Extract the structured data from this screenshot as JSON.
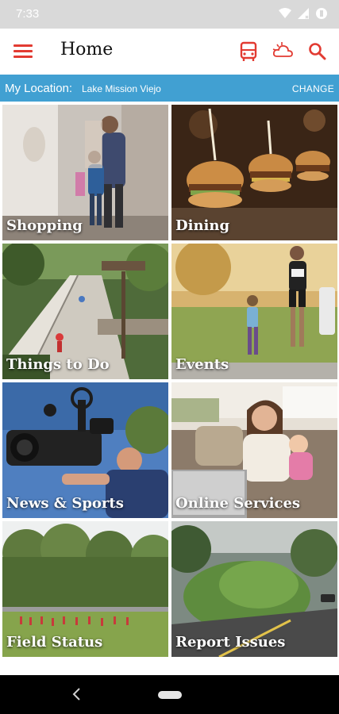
{
  "status_bar": {
    "time": "7:33",
    "icons": [
      "wifi-icon",
      "signal-icon",
      "battery-icon"
    ]
  },
  "app_bar": {
    "title": "Home",
    "menu_icon": "hamburger-menu-icon",
    "actions": [
      "bus-icon",
      "weather-icon",
      "search-icon"
    ],
    "accent": "#e23b32"
  },
  "location": {
    "label": "My Location:",
    "value": "Lake Mission Viejo",
    "change": "CHANGE",
    "bar_color": "#41a0d2"
  },
  "tiles": [
    {
      "label": "Shopping"
    },
    {
      "label": "Dining"
    },
    {
      "label": "Things to Do"
    },
    {
      "label": "Events"
    },
    {
      "label": "News & Sports"
    },
    {
      "label": "Online Services"
    },
    {
      "label": "Field Status"
    },
    {
      "label": "Report Issues"
    }
  ],
  "nav_bar": {
    "icons": [
      "back-icon",
      "home-pill-icon"
    ]
  }
}
